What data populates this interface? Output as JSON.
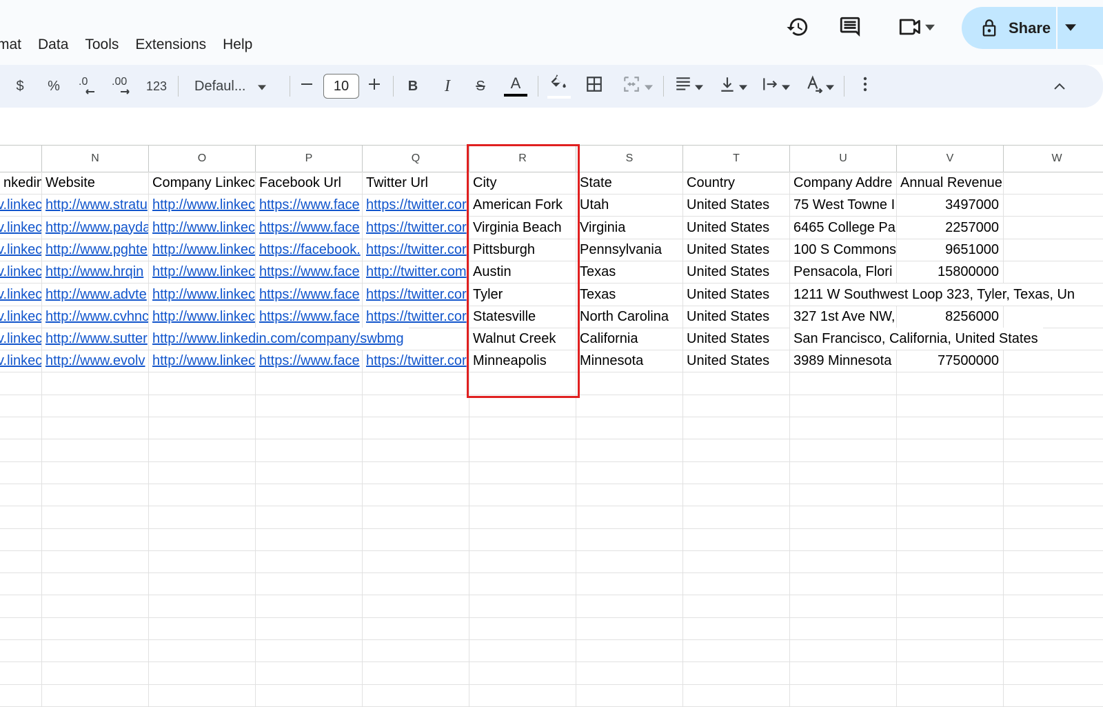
{
  "menu": {
    "items": [
      "mat",
      "Data",
      "Tools",
      "Extensions",
      "Help"
    ]
  },
  "header": {
    "share_label": "Share",
    "icons": [
      "history-icon",
      "comment-icon",
      "meet-icon",
      "lock-icon"
    ]
  },
  "toolbar": {
    "currency": "$",
    "percent": "%",
    "decrease_decimal": ".0",
    "increase_decimal": ".00",
    "number_format": "123",
    "font_name": "Defaul...",
    "font_size": "10",
    "bold": "B",
    "italic": "I",
    "strike": "S",
    "text_color_letter": "A"
  },
  "grid": {
    "columns": [
      "N",
      "O",
      "P",
      "Q",
      "R",
      "S",
      "T",
      "U",
      "V",
      "W"
    ],
    "headers": {
      "m": "nkedin",
      "n": "Website",
      "o": "Company Linkec",
      "p": "Facebook Url",
      "q": "Twitter Url",
      "r": "City",
      "s": "State",
      "t": "Country",
      "u": "Company Addre",
      "v": "Annual Revenue"
    },
    "rows": [
      {
        "m": "v.linkec",
        "n": "http://www.stratu",
        "o": "http://www.linkec",
        "p": "https://www.face",
        "q": "https://twitter.cor",
        "r": "American Fork",
        "s": "Utah",
        "t": "United States",
        "u": "75 West Towne I",
        "v": "3497000"
      },
      {
        "m": "v.linkec",
        "n": "http://www.payda",
        "o": "http://www.linkec",
        "p": "https://www.face",
        "q": "https://twitter.cor",
        "r": "Virginia Beach",
        "s": "Virginia",
        "t": "United States",
        "u": "6465 College Pa",
        "v": "2257000"
      },
      {
        "m": "v.linkec",
        "n": "http://www.pghte",
        "o": "http://www.linkec",
        "p": "https://facebook.",
        "q": "https://twitter.cor",
        "r": "Pittsburgh",
        "s": "Pennsylvania",
        "t": "United States",
        "u": "100 S Commons",
        "v": "9651000"
      },
      {
        "m": "v.linkec",
        "n": "http://www.hrqin",
        "o": "http://www.linkec",
        "p": "https://www.face",
        "q": "http://twitter.com",
        "r": "Austin",
        "s": "Texas",
        "t": "United States",
        "u": "Pensacola, Flori",
        "v": "15800000"
      },
      {
        "m": "v.linkec",
        "n": "http://www.advte",
        "o": "http://www.linkec",
        "p": "https://www.face",
        "q": "https://twitter.cor",
        "r": "Tyler",
        "s": "Texas",
        "t": "United States",
        "u": "1211 W Southwest Loop 323, Tyler, Texas, Un",
        "v": ""
      },
      {
        "m": "v.linkec",
        "n": "http://www.cvhnc",
        "o": "http://www.linkec",
        "p": "https://www.face",
        "q": "https://twitter.cor",
        "r": "Statesville",
        "s": "North Carolina",
        "t": "United States",
        "u": "327 1st Ave NW,",
        "v": "8256000"
      },
      {
        "m": "v.linkec",
        "n": "http://www.sutter",
        "o": "http://www.linkedin.com/company/swbmg",
        "p": "",
        "q": "",
        "r": "Walnut Creek",
        "s": "California",
        "t": "United States",
        "u": "San Francisco, California, United States",
        "v": ""
      },
      {
        "m": "v.linkec",
        "n": "http://www.evolv",
        "o": "http://www.linkec",
        "p": "https://www.face",
        "q": "https://twitter.cor",
        "r": "Minneapolis",
        "s": "Minnesota",
        "t": "United States",
        "u": "3989 Minnesota",
        "v": "77500000"
      }
    ]
  },
  "colors": {
    "accent": "#c2e7ff",
    "toolbar_bg": "#edf2fa",
    "link": "#1155cc",
    "highlight": "#e02020"
  }
}
